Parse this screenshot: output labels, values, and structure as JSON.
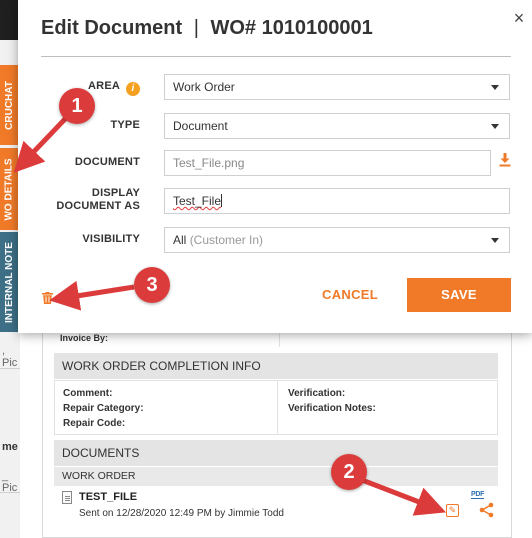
{
  "background": {
    "left_tabs": [
      "CRUCHAT",
      "WO DETAILS",
      "INTERNAL NOTE"
    ],
    "left_fragments": [
      ", Pic",
      "me",
      "_ Pic"
    ],
    "invoice_by_label": "Invoice By:",
    "completion_section": {
      "title": "WORK ORDER COMPLETION INFO",
      "left_fields": [
        "Comment:",
        "Repair Category:",
        "Repair Code:"
      ],
      "right_fields": [
        "Verification:",
        "Verification Notes:"
      ]
    },
    "documents_section": {
      "title": "DOCUMENTS",
      "subheader": "WORK ORDER",
      "item": {
        "name": "TEST_FILE",
        "meta": "Sent on 12/28/2020 12:49 PM by Jimmie Todd",
        "badge": "PDF"
      }
    }
  },
  "modal": {
    "title": "Edit Document",
    "separator": "|",
    "wo_number": "WO# 1010100001",
    "close_symbol": "×",
    "fields": {
      "area": {
        "label": "AREA",
        "value": "Work Order",
        "info_symbol": "i"
      },
      "type": {
        "label": "TYPE",
        "value": "Document"
      },
      "document": {
        "label": "DOCUMENT",
        "value": "Test_File.png"
      },
      "display_as": {
        "label_line1": "DISPLAY",
        "label_line2": "DOCUMENT AS",
        "value": "Test_File"
      },
      "visibility": {
        "label": "VISIBILITY",
        "value": "All",
        "hint": "(Customer In)"
      }
    },
    "cancel_label": "CANCEL",
    "save_label": "SAVE"
  },
  "callouts": [
    "1",
    "2",
    "3"
  ],
  "colors": {
    "accent_orange": "#f07a28",
    "callout_red": "#dc3b3b",
    "teal_tab": "#3d6f86"
  }
}
